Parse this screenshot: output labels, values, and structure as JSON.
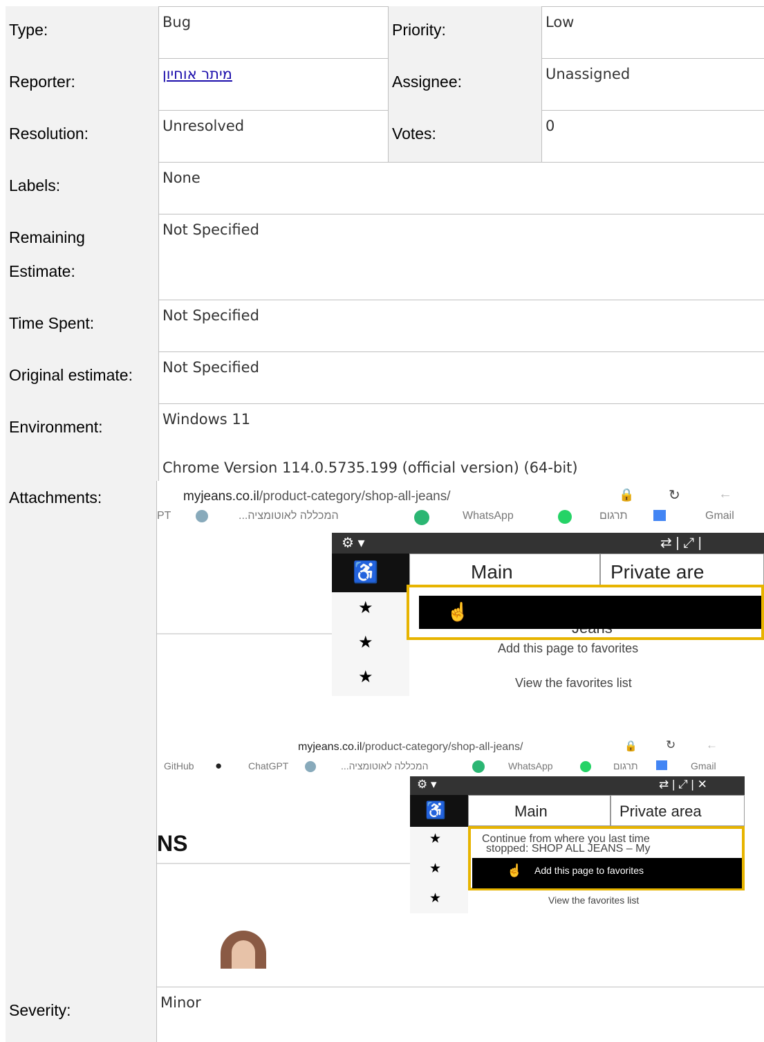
{
  "fields": {
    "type": {
      "label": "Type:",
      "value": "Bug"
    },
    "priority": {
      "label": "Priority:",
      "value": "Low"
    },
    "reporter": {
      "label": "Reporter:",
      "value": "מיתר אוחיון"
    },
    "assignee": {
      "label": "Assignee:",
      "value": "Unassigned"
    },
    "resolution": {
      "label": "Resolution:",
      "value": "Unresolved"
    },
    "votes": {
      "label": "Votes:",
      "value": "0"
    },
    "labels": {
      "label": "Labels:",
      "value": "None"
    },
    "remaining_estimate": {
      "label_line1": "Remaining",
      "label_line2": "Estimate:",
      "value": "Not Specified"
    },
    "time_spent": {
      "label": "Time Spent:",
      "value": "Not Specified"
    },
    "original_estimate": {
      "label": "Original estimate:",
      "value": "Not Specified"
    },
    "environment": {
      "label": "Environment:",
      "line1": "Windows 11",
      "line2": "Chrome Version 114.0.5735.199 (official version) (64-bit)"
    },
    "attachments": {
      "label": "Attachments:"
    },
    "severity": {
      "label": "Severity:",
      "value": "Minor"
    }
  },
  "attachment1": {
    "url_domain": "myjeans.co.il",
    "url_path": "/product-category/shop-all-jeans/",
    "bookmarks": [
      "PT",
      "...המכללה לאוטומציה",
      "WhatsApp",
      "תרגום",
      "Gmail"
    ],
    "tab_main": "Main",
    "tab_private": "Private are",
    "overflow_text": "Jeans",
    "add_fav": "Add this page to favorites",
    "view_fav": "View the favorites list"
  },
  "attachment2": {
    "url_domain": "myjeans.co.il",
    "url_path": "/product-category/shop-all-jeans/",
    "bookmarks": [
      "GitHub",
      "ChatGPT",
      "...המכללה לאוטומציה",
      "WhatsApp",
      "תרגום",
      "Gmail"
    ],
    "tab_main": "Main",
    "tab_private": "Private area",
    "continue_line1": "Continue from where you last time",
    "continue_line2": "stopped: SHOP ALL JEANS – My",
    "add_fav": "Add this page to favorites",
    "view_fav": "View the favorites list",
    "page_heading_fragment": "NS"
  },
  "colors": {
    "highlight": "#e7b400",
    "label_bg": "#f2f2f2",
    "link": "#1a0dab"
  }
}
